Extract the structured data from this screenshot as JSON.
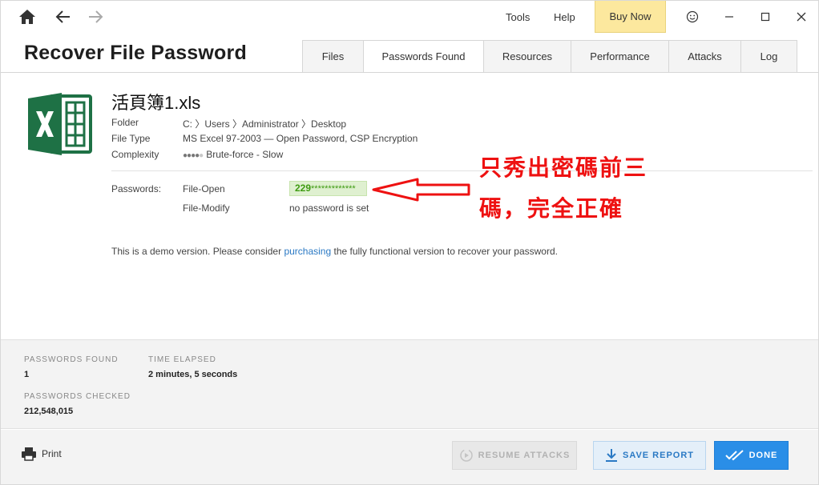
{
  "titlebar": {
    "icons": {
      "home": "home-icon",
      "back": "back-arrow-icon",
      "forward": "forward-arrow-icon",
      "feedback": "smiley-icon"
    },
    "menu": {
      "tools": "Tools",
      "help": "Help"
    },
    "buy_now": "Buy Now",
    "window_controls": [
      "minimize",
      "maximize",
      "close"
    ]
  },
  "header": {
    "title": "Recover File Password",
    "tabs": [
      {
        "label": "Files",
        "active": false
      },
      {
        "label": "Passwords Found",
        "active": true
      },
      {
        "label": "Resources",
        "active": false
      },
      {
        "label": "Performance",
        "active": false
      },
      {
        "label": "Attacks",
        "active": false
      },
      {
        "label": "Log",
        "active": false
      }
    ]
  },
  "file": {
    "icon": "excel-file-icon",
    "name": "活頁簿1.xls",
    "folder_label": "Folder",
    "folder_value": "C: 〉Users 〉Administrator 〉Desktop",
    "type_label": "File Type",
    "type_value": "MS Excel 97-2003 — Open Password, CSP Encryption",
    "complexity_label": "Complexity",
    "complexity_level": 4,
    "complexity_max": 5,
    "complexity_value": "Brute-force - Slow"
  },
  "passwords": {
    "label": "Passwords:",
    "open_label": "File-Open",
    "open_prefix": "229",
    "open_mask": "*************",
    "modify_label": "File-Modify",
    "modify_value": "no password is set"
  },
  "demo": {
    "before": "This is a demo version. Please consider ",
    "link": "purchasing",
    "after": " the fully functional version to recover your password."
  },
  "annotation": {
    "line1": "只秀出密碼前三",
    "line2": "碼，完全正確",
    "color": "#ee1111"
  },
  "stats": {
    "found_label": "PASSWORDS FOUND",
    "found_value": "1",
    "elapsed_label": "TIME ELAPSED",
    "elapsed_value": "2 minutes, 5 seconds",
    "checked_label": "PASSWORDS CHECKED",
    "checked_value": "212,548,015"
  },
  "footer": {
    "print": "Print",
    "resume": "RESUME ATTACKS",
    "save": "SAVE REPORT",
    "done": "DONE"
  },
  "colors": {
    "accent": "#2a8ee7",
    "buy_now_bg": "#fce89e",
    "password_green": "#3e9b11",
    "excel_green": "#1e7145",
    "link": "#2a79c4"
  }
}
